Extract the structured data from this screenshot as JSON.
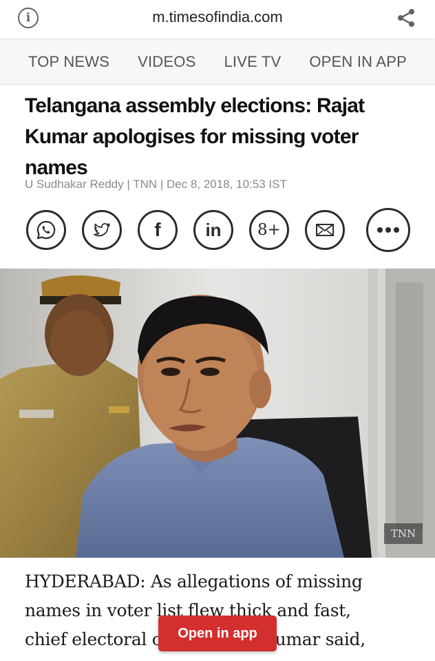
{
  "browser": {
    "url": "m.timesofindia.com",
    "info_icon": "info-icon",
    "share_icon": "share-icon"
  },
  "nav": {
    "items": [
      "TOP NEWS",
      "VIDEOS",
      "LIVE TV",
      "OPEN IN APP"
    ]
  },
  "article": {
    "headline": "Telangana assembly elections: Rajat Kumar apologises for missing voter names",
    "byline": "U Sudhakar Reddy | TNN | Dec 8, 2018, 10:53 IST",
    "image_credit": "TNN",
    "body_lines": [
      "HYDERABAD: As allegations of missing",
      "names in voter list flew thick and fast,",
      "chief electoral officer Rajat Kumar said,"
    ]
  },
  "share": {
    "buttons": [
      {
        "icon": "whatsapp-icon"
      },
      {
        "icon": "twitter-icon"
      },
      {
        "icon": "facebook-icon",
        "label": "f"
      },
      {
        "icon": "linkedin-icon",
        "label": "in"
      },
      {
        "icon": "google-plus-icon",
        "label": "8+"
      },
      {
        "icon": "email-icon"
      },
      {
        "icon": "more-icon"
      }
    ]
  },
  "cta": {
    "open_in_app": "Open in app",
    "color": "#d32f2f"
  }
}
